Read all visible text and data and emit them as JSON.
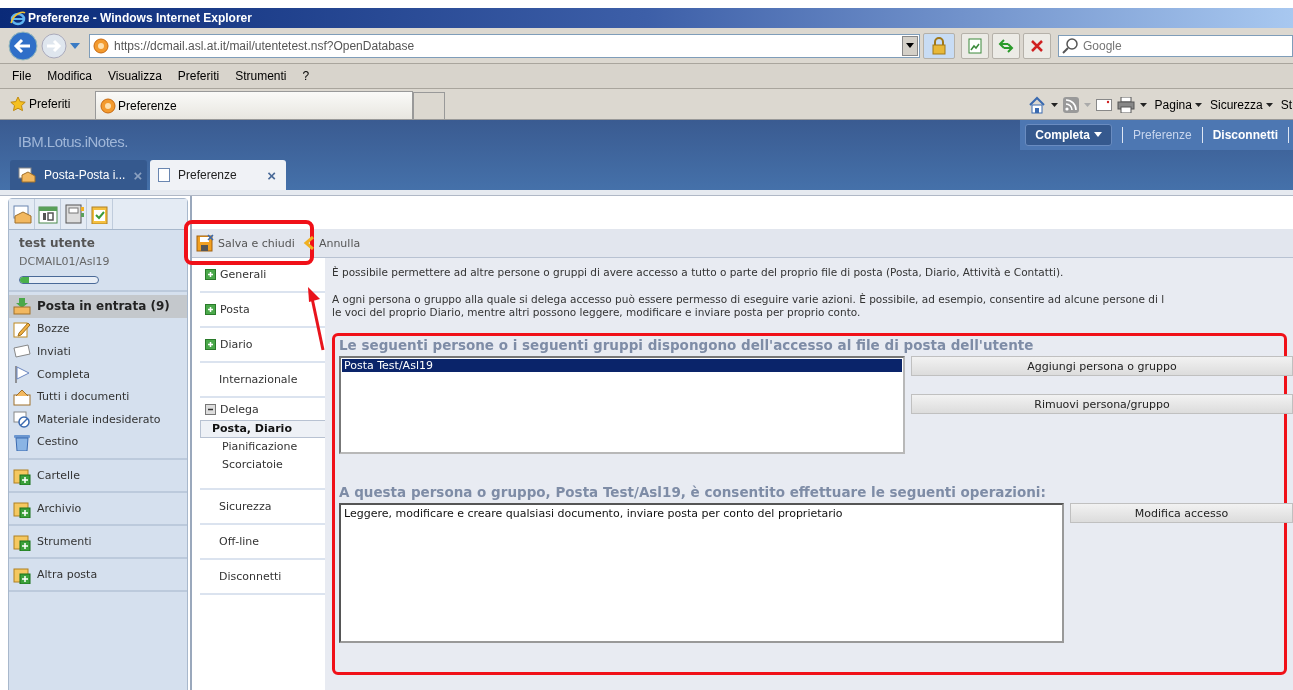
{
  "window": {
    "title": "Preferenze - Windows Internet Explorer"
  },
  "address_bar": {
    "url": "https://dcmail.asl.at.it/mail/utentetest.nsf?OpenDatabase"
  },
  "search": {
    "placeholder": "Google"
  },
  "menu": [
    "File",
    "Modifica",
    "Visualizza",
    "Preferiti",
    "Strumenti",
    "?"
  ],
  "favorites": {
    "label": "Preferiti",
    "tabs": [
      {
        "label": "Preferenze",
        "selected": true
      }
    ]
  },
  "command_bar": [
    "Pagina",
    "Sicurezza",
    "St"
  ],
  "app": {
    "logo": "IBM.Lotus.iNotes.",
    "header_links": [
      {
        "label": "Completa",
        "kind": "menu"
      },
      {
        "label": "Preferenze",
        "kind": "link"
      },
      {
        "label": "Disconnetti",
        "kind": "bold"
      }
    ],
    "tabs": [
      {
        "label": "Posta-Posta i...",
        "selected": false,
        "close": "×"
      },
      {
        "label": "Preferenze",
        "selected": true,
        "close": "×"
      }
    ]
  },
  "sidebar": {
    "user": "test utente",
    "server": "DCMAIL01/Asl19",
    "quota": {
      "level": 0.12
    },
    "folders": [
      {
        "label": "Posta in entrata (9)",
        "selected": true
      },
      {
        "label": "Bozze",
        "selected": false
      },
      {
        "label": "Inviati",
        "selected": false
      },
      {
        "label": "Completa",
        "selected": false
      },
      {
        "label": "Tutti i documenti",
        "selected": false
      },
      {
        "label": "Materiale indesiderato",
        "selected": false
      },
      {
        "label": "Cestino",
        "selected": false
      }
    ],
    "sections": [
      "Cartelle",
      "Archivio",
      "Strumenti",
      "Altra posta"
    ]
  },
  "toolbar": [
    {
      "label": "Salva e chiudi",
      "highlighted": true
    },
    {
      "label": "Annulla",
      "highlighted": false
    }
  ],
  "nav": [
    {
      "label": "Generali",
      "expanded": false
    },
    {
      "label": "Posta",
      "expanded": false
    },
    {
      "label": "Diario",
      "expanded": false
    },
    {
      "label": "Internazionale"
    },
    {
      "label": "Delega",
      "expanded": true,
      "children": [
        {
          "label": "Posta, Diario",
          "selected": true
        },
        {
          "label": "Pianificazione",
          "selected": false
        },
        {
          "label": "Scorciatoie",
          "selected": false
        }
      ]
    },
    {
      "label": "Sicurezza"
    },
    {
      "label": "Off-line"
    },
    {
      "label": "Disconnetti"
    }
  ],
  "intro": [
    {
      "lines": [
        "È possibile permettere ad altre persone o gruppi di avere accesso a tutto o parte del proprio file di posta (Posta, Diario, Attività e Contatti)."
      ]
    },
    {
      "lines": [
        "A ogni persona o gruppo alla quale si delega accesso può essere permesso di eseguire varie azioni. È possibile, ad esempio, consentire ad alcune persone di l",
        "le voci del proprio Diario, mentre altri possono leggere, modificare e inviare posta per proprio conto."
      ]
    }
  ],
  "delegates": {
    "title": "Le seguenti persone o i seguenti gruppi dispongono dell'accesso al file di posta dell'utente",
    "items": [
      {
        "label": "Posta Test/Asl19",
        "selected": true
      }
    ],
    "buttons": [
      "Aggiungi persona o gruppo",
      "Rimuovi persona/gruppo"
    ]
  },
  "permissions": {
    "title": "A questa persona o gruppo, Posta Test/Asl19, è consentito effettuare le seguenti operazioni:",
    "value": "Leggere, modificare e creare qualsiasi documento, inviare posta per conto del proprietario",
    "button": "Modifica accesso"
  }
}
